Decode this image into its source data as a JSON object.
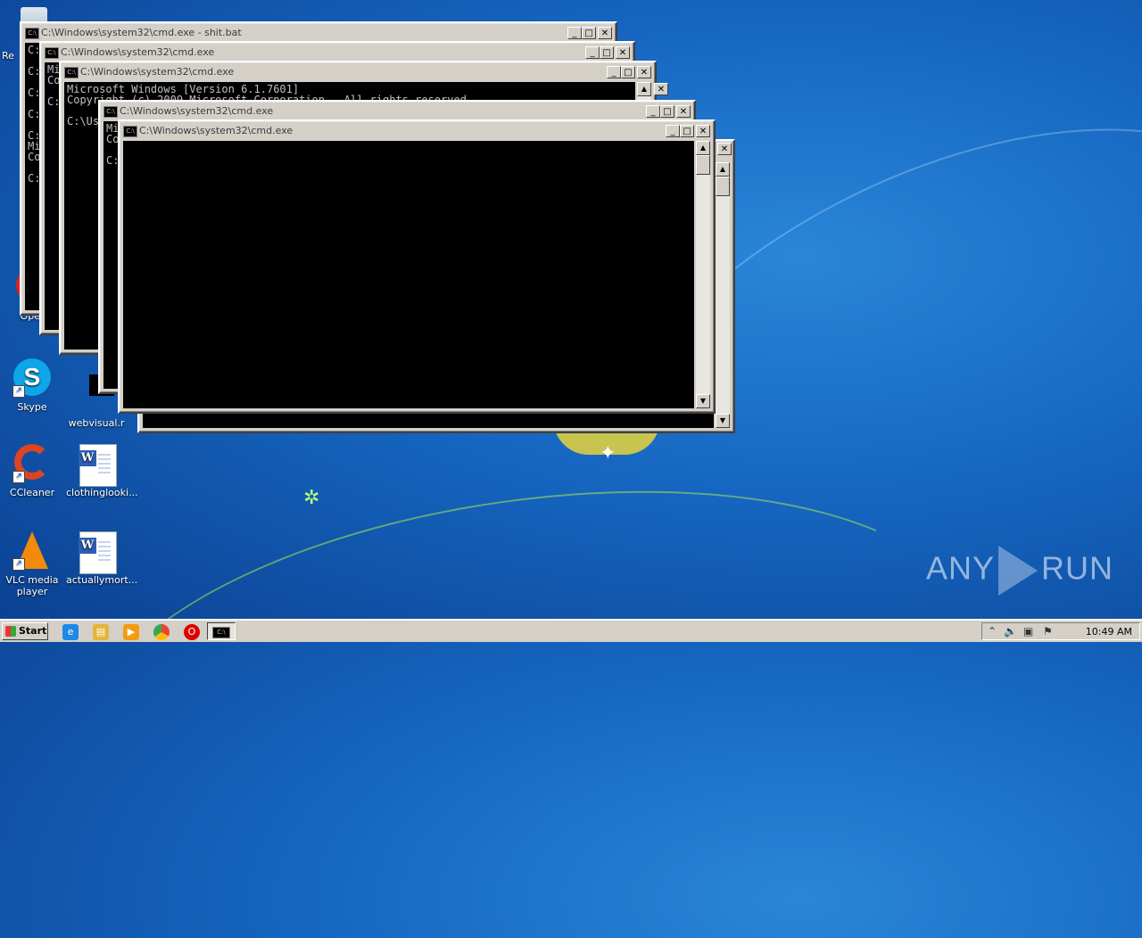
{
  "desktop": {
    "icons": [
      {
        "label": "Re",
        "icon": "recycle-bin-icon"
      },
      {
        "label": "Skype",
        "icon": "skype-icon"
      },
      {
        "label": "webvisual.r",
        "icon": "cmd-file-icon"
      },
      {
        "label": "CCleaner",
        "icon": "ccleaner-icon"
      },
      {
        "label": "clothinglooki...",
        "icon": "word-doc-icon"
      },
      {
        "label": "VLC media player",
        "icon": "vlc-icon"
      },
      {
        "label": "actuallymort...",
        "icon": "word-doc-icon"
      },
      {
        "label": "Oper",
        "icon": "opera-icon"
      }
    ]
  },
  "windows": [
    {
      "title": "C:\\Windows\\system32\\cmd.exe - shit.bat",
      "console": "C:\n\nC:\n\nC:\n\nC:\n\nC:\nMi\nCo\n\nC:"
    },
    {
      "title": "C:\\Windows\\system32\\cmd.exe",
      "console": "Mi\nCo\n\nC:"
    },
    {
      "title": "C:\\Windows\\system32\\cmd.exe",
      "console": "Microsoft Windows [Version 6.1.7601]\nCopyright (c) 2009 Microsoft Corporation.  All rights reserved.\n\nC:\\Us"
    },
    {
      "title": "C:\\Windows\\system32\\cmd.exe",
      "console": "Mi\nCo\n\nC:"
    },
    {
      "title": "C:\\Windows\\system32\\cmd.exe",
      "console": ""
    }
  ],
  "taskbar": {
    "start_label": "Start",
    "pinned": [
      "ie-icon",
      "explorer-icon",
      "media-player-icon",
      "chrome-icon",
      "opera-icon"
    ],
    "clock": "10:49 AM"
  },
  "watermark": {
    "left": "ANY",
    "right": "RUN"
  },
  "colors": {
    "wallpaper": "#1565c0",
    "window_face": "#d4d0c8",
    "console_bg": "#000000"
  }
}
